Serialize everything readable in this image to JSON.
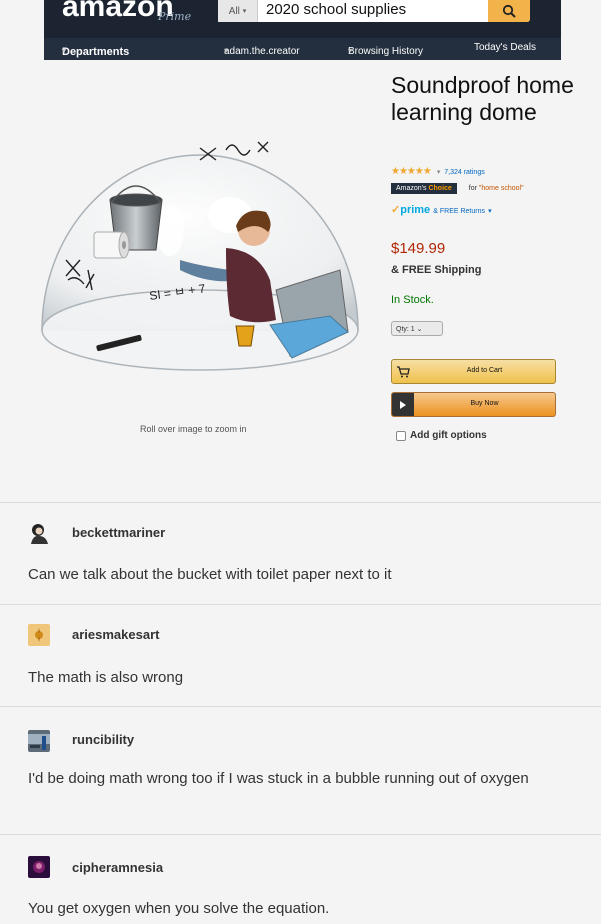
{
  "header": {
    "logo": "amazon",
    "logo_sub": "Prime",
    "search_category": "All",
    "search_query": "2020 school supplies",
    "nav": {
      "departments": "Departments",
      "account": "adam.the.creator",
      "history": "Browsing History",
      "deals": "Today's Deals"
    }
  },
  "product": {
    "title": "Soundproof home learning dome",
    "ratings": "7,324 ratings",
    "badge_prefix": "Amazon's",
    "badge_suffix": "Choice",
    "badge_for": "for",
    "badge_query": "\"home school\"",
    "prime": "prime",
    "returns": "& FREE Returns",
    "price": "$149.99",
    "shipping": "& FREE Shipping",
    "stock": "In Stock.",
    "qty": "Qty: 1",
    "add_to_cart": "Add to Cart",
    "buy_now": "Buy Now",
    "gift": "Add gift options",
    "zoom_hint": "Roll over image to zoom in",
    "math_text": "SI = ㅂ + 7"
  },
  "posts": [
    {
      "user": "beckettmariner",
      "text": "Can we talk about the bucket with toilet paper next to it"
    },
    {
      "user": "ariesmakesart",
      "text": "The math is also wrong"
    },
    {
      "user": "runcibility",
      "text": "I'd be doing math wrong too if I was stuck in a bubble running out of oxygen"
    },
    {
      "user": "cipheramnesia",
      "text": "You get oxygen when you solve the equation."
    }
  ]
}
